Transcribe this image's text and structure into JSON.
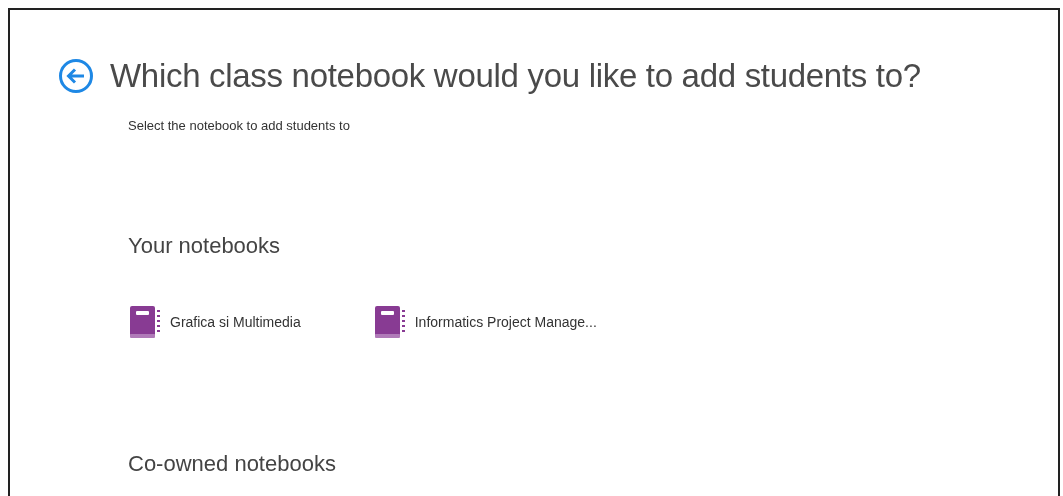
{
  "header": {
    "title": "Which class notebook would you like to add students to?",
    "subtitle": "Select the notebook to add students to"
  },
  "sections": [
    {
      "heading": "Your notebooks",
      "notebooks": [
        {
          "name": "Grafica si Multimedia"
        },
        {
          "name": "Informatics Project Manage..."
        }
      ]
    },
    {
      "heading": "Co-owned notebooks"
    }
  ]
}
